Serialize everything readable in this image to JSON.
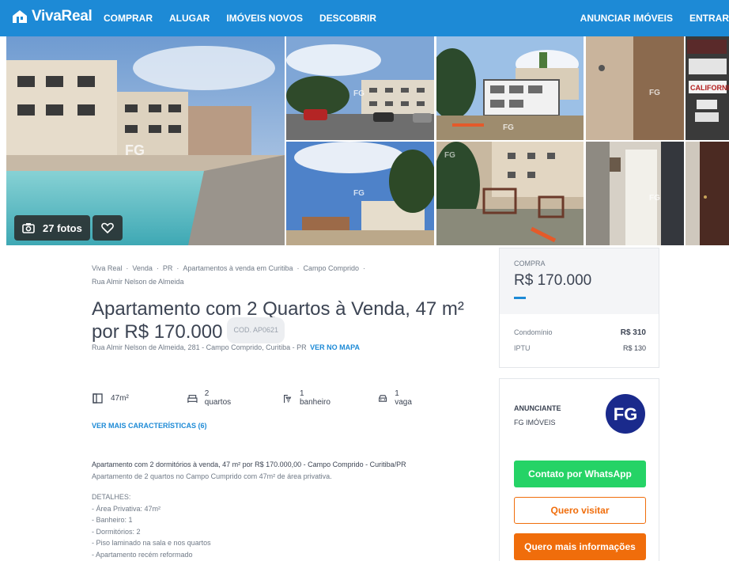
{
  "header": {
    "brand": "VivaReal",
    "nav_left": [
      "COMPRAR",
      "ALUGAR",
      "IMÓVEIS NOVOS",
      "DESCOBRIR"
    ],
    "nav_right": [
      "ANUNCIAR IMÓVEIS",
      "ENTRAR"
    ]
  },
  "gallery": {
    "photo_count_label": "27 fotos",
    "watermark": "FG"
  },
  "breadcrumb": [
    "Viva Real",
    "Venda",
    "PR",
    "Apartamentos à venda em Curitiba",
    "Campo Comprido",
    "Rua Almir Nelson de Almeida"
  ],
  "listing": {
    "title_line1": "Apartamento com 2 Quartos à Venda, 47 m²",
    "title_line2": "por R$ 170.000",
    "code": "COD. AP0621",
    "address": "Rua Almir Nelson de Almeida, 281 - Campo Comprido, Curitiba - PR",
    "map_link": "VER NO MAPA"
  },
  "features": {
    "area": "47m²",
    "bedrooms": "2 quartos",
    "bathrooms": "1 banheiro",
    "parking": "1 vaga",
    "more_link": "VER MAIS CARACTERÍSTICAS (6)"
  },
  "description": {
    "headline": "Apartamento com 2 dormitórios à venda, 47 m² por R$ 170.000,00 - Campo Comprido - Curitiba/PR",
    "subline": "Apartamento de 2 quartos no Campo Cumprido com 47m² de área privativa.",
    "details_title": "DETALHES:",
    "details": [
      "- Área Privativa: 47m²",
      "- Banheiro: 1",
      "- Dormitórios: 2",
      "- Piso laminado na sala e nos quartos",
      "- Apartamento recém reformado"
    ]
  },
  "price_card": {
    "label": "COMPRA",
    "price": "R$ 170.000",
    "condo_label": "Condomínio",
    "condo_value": "R$ 310",
    "iptu_label": "IPTU",
    "iptu_value": "R$ 130"
  },
  "advertiser": {
    "label": "ANUNCIANTE",
    "name": "FG IMÓVEIS",
    "logo_text": "FG",
    "whatsapp_button": "Contato por WhatsApp",
    "visit_button": "Quero visitar",
    "info_button": "Quero mais informações"
  },
  "colors": {
    "brand_blue": "#1d8ad6",
    "whatsapp_green": "#25d366",
    "orange": "#f06d0b",
    "logo_navy": "#1a2a8c"
  }
}
